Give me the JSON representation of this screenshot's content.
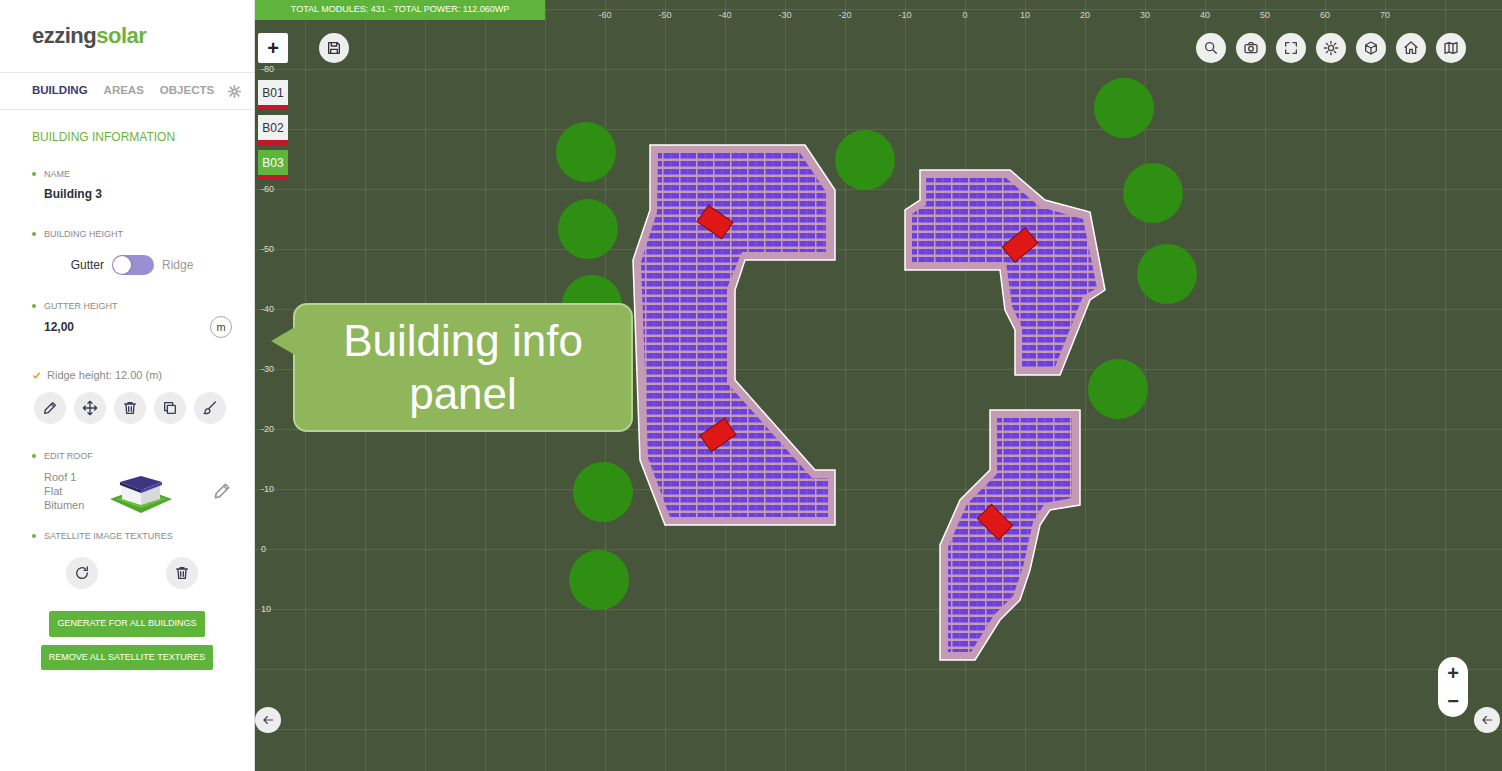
{
  "logo": {
    "text": "ezzing",
    "accent": "solar"
  },
  "tabs": [
    {
      "label": "BUILDING",
      "selected": true
    },
    {
      "label": "AREAS",
      "selected": false
    },
    {
      "label": "OBJECTS",
      "selected": false
    }
  ],
  "section_title": "BUILDING INFORMATION",
  "name": {
    "label": "NAME",
    "value": "Building 3"
  },
  "building_height": {
    "label": "BUILDING HEIGHT",
    "left": "Gutter",
    "right": "Ridge",
    "on": false
  },
  "gutter_height": {
    "label": "GUTTER HEIGHT",
    "value": "12,00",
    "unit": "m"
  },
  "ridge_height": "Ridge height: 12.00 (m)",
  "edit_roof": {
    "label": "EDIT ROOF",
    "lines": [
      "Roof 1",
      "Flat",
      "Bitumen"
    ]
  },
  "satellite_textures": {
    "label": "SATELLITE IMAGE TEXTURES"
  },
  "buttons": [
    "GENERATE FOR ALL BUILDINGS",
    "REMOVE ALL SATELLITE TEXTURES"
  ],
  "map": {
    "status": "TOTAL MODULES: 431 - TOTAL POWER: 112.060WP",
    "add_button": "+",
    "x_ticks": [
      "-60",
      "-50",
      "-40",
      "-30",
      "-20",
      "-10",
      "0",
      "10",
      "20",
      "30",
      "40",
      "50",
      "60",
      "70"
    ],
    "y_ticks": [
      "-80",
      "-60",
      "-50",
      "-40",
      "-30",
      "-20",
      "-10",
      "0",
      "10"
    ],
    "building_tabs": [
      {
        "label": "B01",
        "selected": false
      },
      {
        "label": "B02",
        "selected": false
      },
      {
        "label": "B03",
        "selected": true
      }
    ],
    "zoom_in": "+",
    "zoom_out": "−"
  },
  "callout": "Building info panel"
}
